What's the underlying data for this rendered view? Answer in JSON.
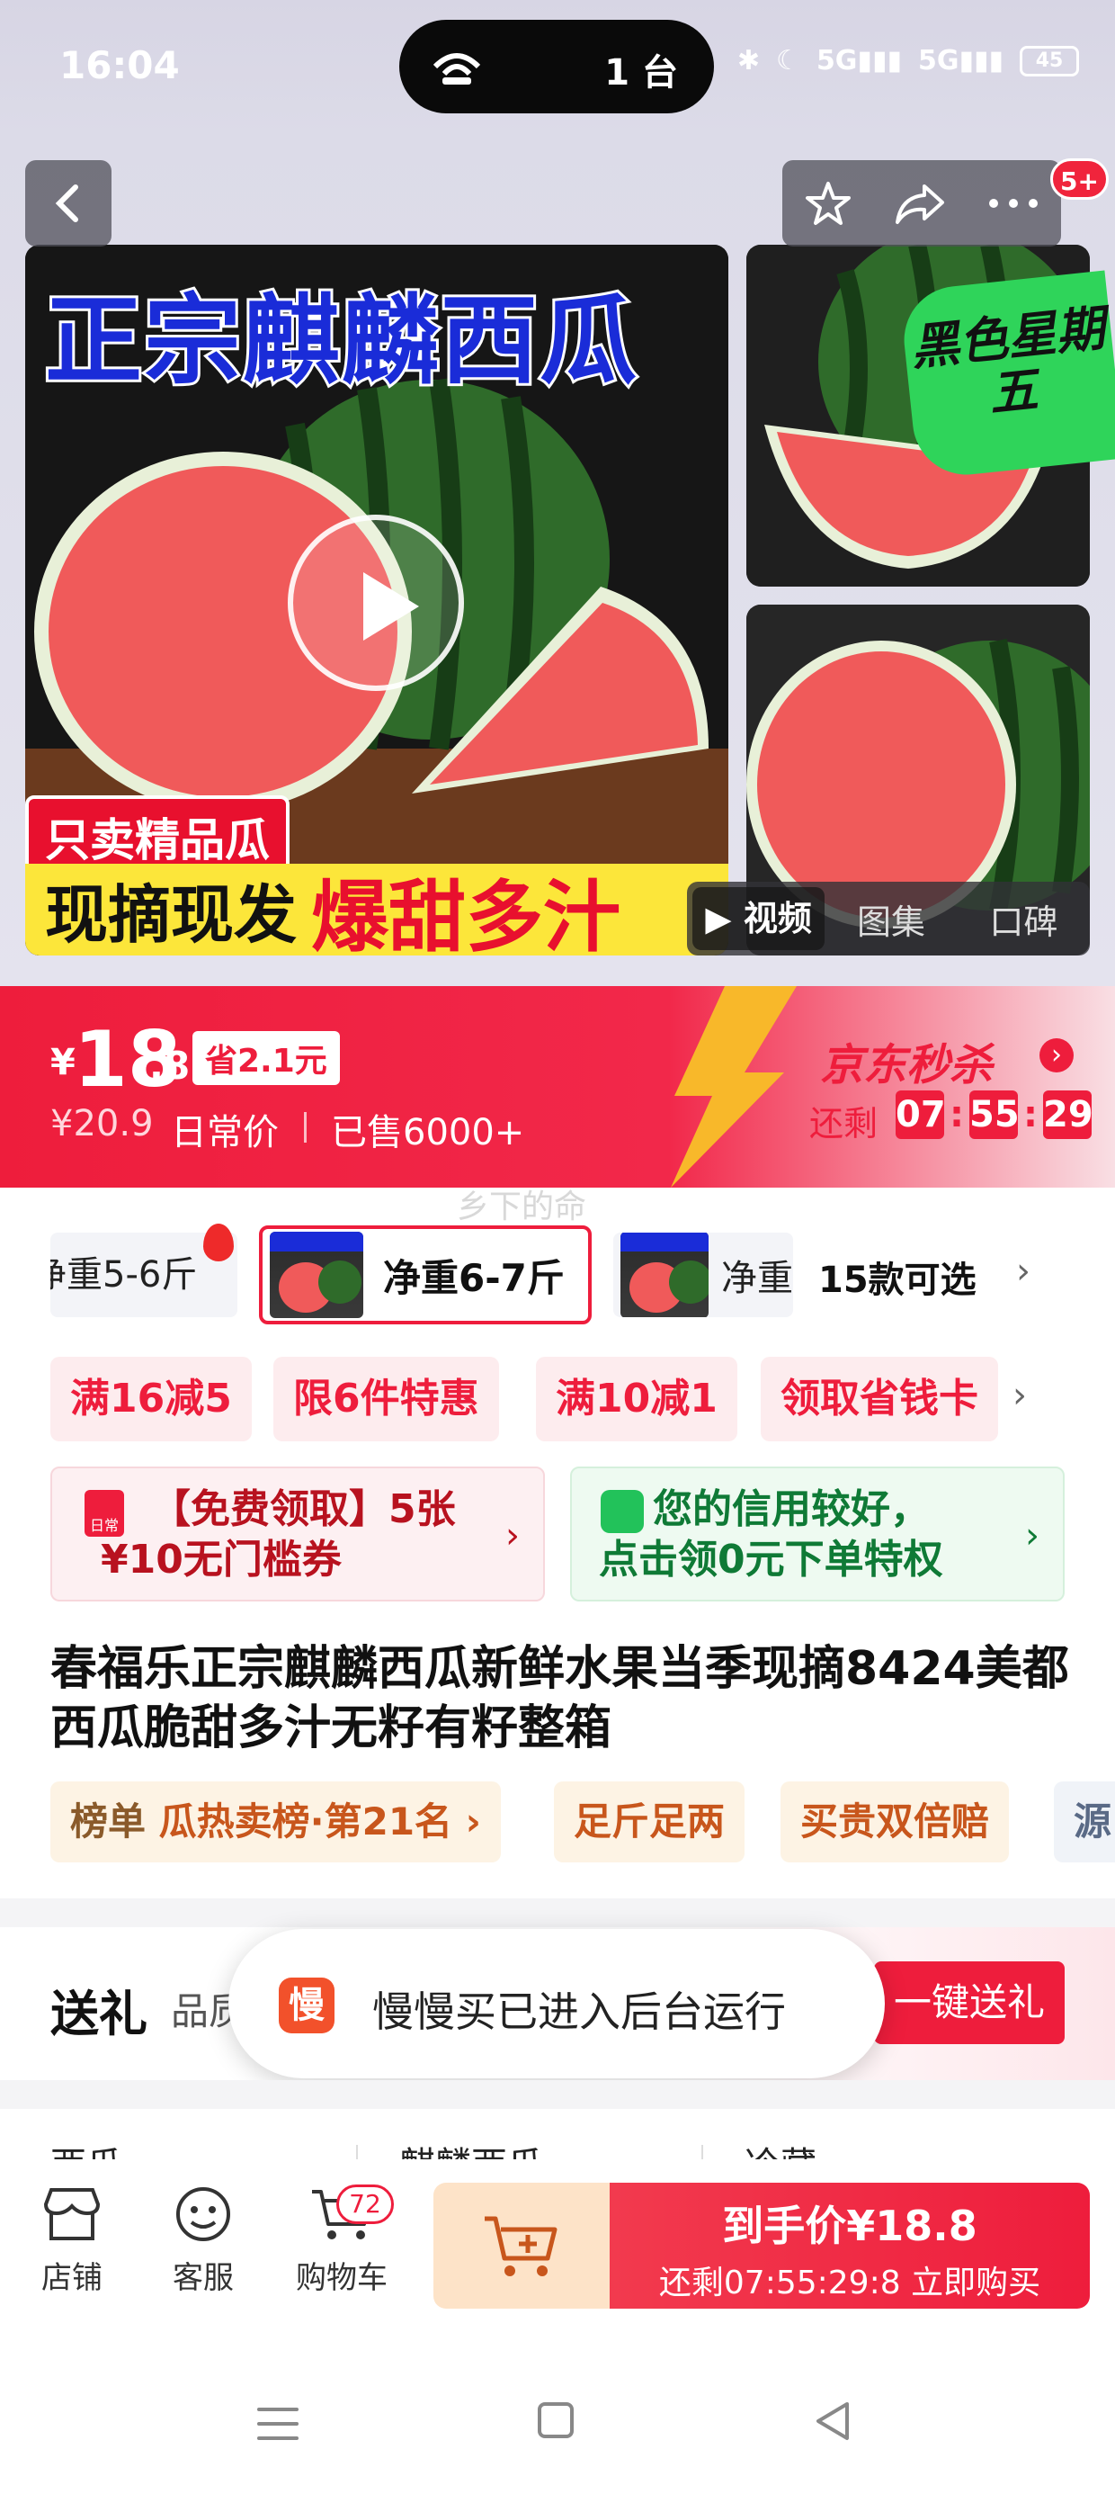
{
  "status_bar": {
    "time": "16:04",
    "island_count": "1 台",
    "battery": "45"
  },
  "gallery": {
    "main_title": "正宗麒麟西瓜",
    "tag_jp": "只卖精品瓜",
    "tag_a": "现摘现发",
    "tag_b": "爆甜多汁",
    "badge_black_friday": "黑色星期五",
    "share_badge": "5+",
    "media_tabs": [
      "视频",
      "图集",
      "口碑"
    ]
  },
  "price": {
    "currency": "¥",
    "integer": "18",
    "decimal": ".8",
    "save": "省2.1元",
    "original": "¥20.9",
    "original_label": "日常价",
    "sold": "已售6000+",
    "flash_title": "京东秒杀",
    "remain_label": "还剩",
    "timer": [
      "07",
      "55",
      "29"
    ]
  },
  "watermark": "乡下的命",
  "variants": {
    "items": [
      "净重5-6斤",
      "净重6-7斤",
      "净重"
    ],
    "thumb_text": "正宗麒麟西瓜",
    "more": "15款可选"
  },
  "promos": [
    "满16减5",
    "限6件特惠",
    "满10减1",
    "领取省钱卡"
  ],
  "coupons": {
    "left_line1": "【免费领取】5张",
    "left_line2": "¥10无门槛券",
    "left_icon": "日常",
    "right_line1": "您的信用较好，",
    "right_line2": "点击领0元下单特权"
  },
  "product_title": "春福乐正宗麒麟西瓜新鲜水果当季现摘8424美都西瓜脆甜多汁无籽有籽整箱",
  "tags": {
    "rank_prefix": "榜单",
    "rank_text": "瓜热卖榜·第21名",
    "t2": "足斤足两",
    "t3": "买贵双倍赔",
    "t4": "源"
  },
  "gift": {
    "title": "送礼",
    "sub": "品质",
    "button": "一键送礼"
  },
  "toast": {
    "icon_char": "慢",
    "text": "慢慢买已进入后台运行"
  },
  "categories": [
    "西瓜",
    "麒麟西瓜",
    "冷藏"
  ],
  "bottom_bar": {
    "store": "店铺",
    "service": "客服",
    "cart": "购物车",
    "cart_count": "72",
    "buy_top": "到手价¥18.8",
    "buy_bottom": "还剩07:55:29:8  立即购买"
  },
  "colors": {
    "accent": "#ee1d3c",
    "green": "#22c25a",
    "title_blue": "#1a2cd8"
  }
}
